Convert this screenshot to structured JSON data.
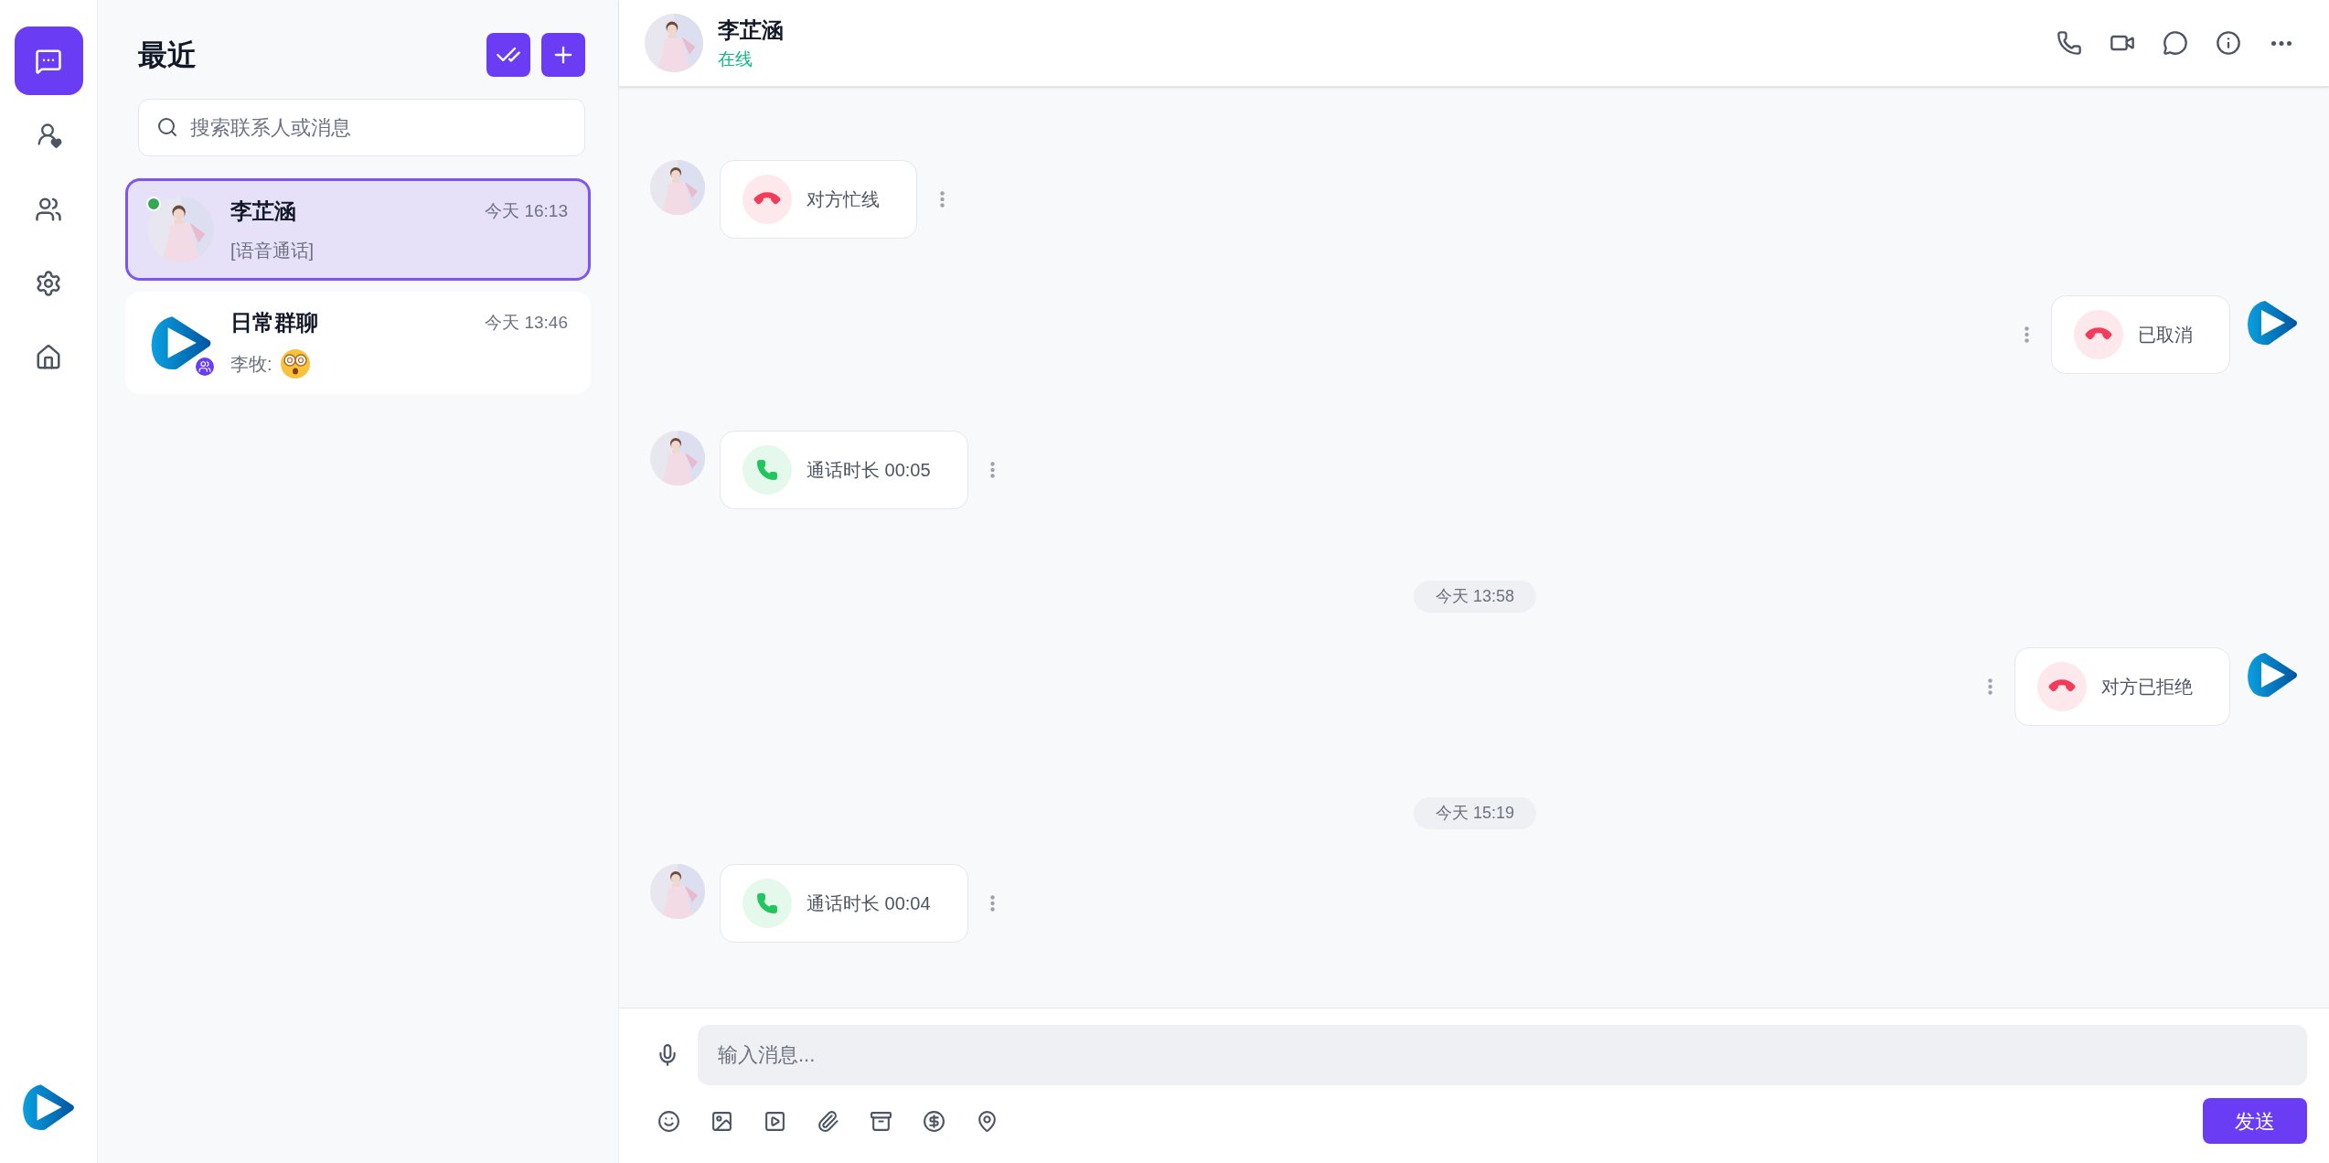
{
  "rail": {
    "items": [
      {
        "kind": "chat",
        "selected": true
      },
      {
        "kind": "favorite-contacts",
        "selected": false
      },
      {
        "kind": "friends",
        "selected": false
      },
      {
        "kind": "settings",
        "selected": false
      },
      {
        "kind": "home",
        "selected": false
      }
    ]
  },
  "recent": {
    "title": "最近",
    "search": {
      "placeholder": "搜索联系人或消息"
    },
    "conversations": [
      {
        "name": "李芷涵",
        "time": "今天 16:13",
        "preview": "[语音通话]",
        "online": true,
        "group": false,
        "emoji": false,
        "selected": true
      },
      {
        "name": "日常群聊",
        "time": "今天 13:46",
        "preview": "李牧:",
        "kind": "logo",
        "online": false,
        "group": true,
        "emoji": true,
        "selected": false
      }
    ]
  },
  "chat": {
    "name": "李芷涵",
    "status": "在线",
    "messages": [
      {
        "kind": "call",
        "outgoing": false,
        "missed": true,
        "text": "对方忙线"
      },
      {
        "kind": "call",
        "outgoing": true,
        "missed": true,
        "text": "已取消"
      },
      {
        "kind": "call",
        "outgoing": false,
        "missed": false,
        "text": "通话时长 00:05"
      },
      {
        "kind": "time",
        "text": "今天 13:58"
      },
      {
        "kind": "call",
        "outgoing": true,
        "missed": true,
        "text": "对方已拒绝"
      },
      {
        "kind": "time",
        "text": "今天 15:19"
      },
      {
        "kind": "call",
        "outgoing": false,
        "missed": false,
        "text": "通话时长 00:04"
      }
    ],
    "input": {
      "placeholder": "输入消息..."
    },
    "send": "发送"
  }
}
